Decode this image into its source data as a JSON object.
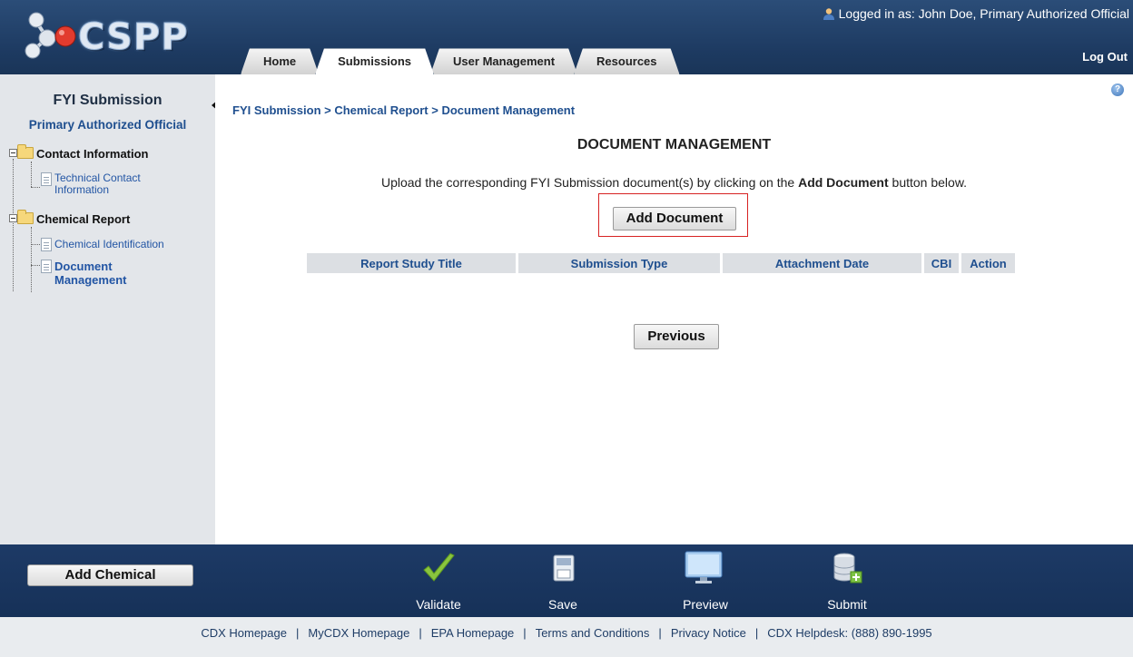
{
  "header": {
    "logo_text": "CSPP",
    "login_info": "Logged in as: John Doe, Primary Authorized Official",
    "logout": "Log Out",
    "tabs": [
      {
        "label": "Home",
        "active": false
      },
      {
        "label": "Submissions",
        "active": true
      },
      {
        "label": "User Management",
        "active": false
      },
      {
        "label": "Resources",
        "active": false
      }
    ]
  },
  "sidebar": {
    "title": "FYI Submission",
    "role": "Primary Authorized Official",
    "tree": {
      "contact_folder": "Contact Information",
      "technical_contact_line1": "Technical Contact",
      "technical_contact_line2": "Information",
      "chemical_folder": "Chemical Report",
      "chemical_identification": "Chemical Identification",
      "document_management_line1": "Document",
      "document_management_line2": "Management"
    }
  },
  "main": {
    "breadcrumb": "FYI Submission > Chemical Report > Document Management",
    "title": "DOCUMENT MANAGEMENT",
    "instruction_prefix": "Upload the corresponding FYI Submission document(s) by clicking on the ",
    "instruction_bold": "Add Document",
    "instruction_suffix": " button below.",
    "add_document_label": "Add Document",
    "table_headers": [
      "Report Study Title",
      "Submission Type",
      "Attachment Date",
      "CBI",
      "Action"
    ],
    "previous_label": "Previous",
    "help_glyph": "?"
  },
  "toolbar": {
    "add_chemical_label": "Add Chemical",
    "validate_label": "Validate",
    "save_label": "Save",
    "preview_label": "Preview",
    "submit_label": "Submit"
  },
  "footer": {
    "links": [
      "CDX Homepage",
      "MyCDX Homepage",
      "EPA Homepage",
      "Terms and Conditions",
      "Privacy Notice",
      "CDX Helpdesk: (888) 890-1995"
    ]
  },
  "colors": {
    "header_bg": "#1d3a61",
    "link_blue": "#1f4f8f",
    "highlight_red": "#d72222"
  }
}
